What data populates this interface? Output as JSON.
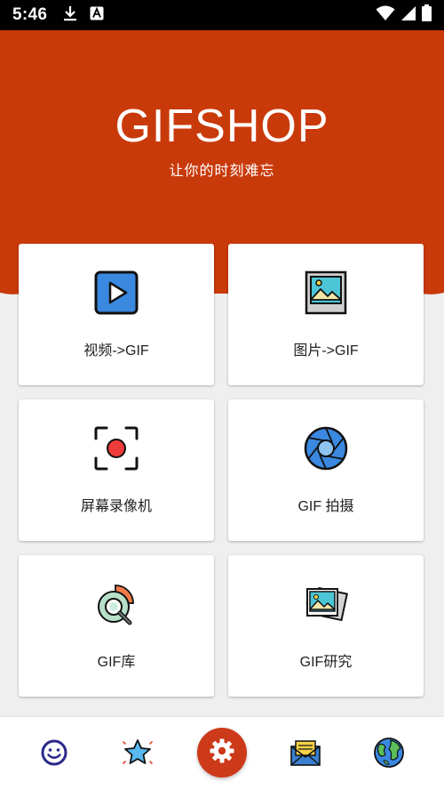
{
  "status_bar": {
    "time": "5:46",
    "notification_icons": [
      "download-icon",
      "font-a-icon"
    ],
    "system_icons": [
      "wifi-icon",
      "signal-icon",
      "battery-icon"
    ]
  },
  "header": {
    "title": "GIFSHOP",
    "slogan": "让你的时刻难忘",
    "background_color": "#c93a0b"
  },
  "tiles": [
    {
      "label": "视频->GIF",
      "icon": "video-play-icon"
    },
    {
      "label": "图片->GIF",
      "icon": "picture-icon"
    },
    {
      "label": "屏幕录像机",
      "icon": "screen-record-icon"
    },
    {
      "label": "GIF 拍摄",
      "icon": "camera-aperture-icon"
    },
    {
      "label": "GIF库",
      "icon": "gif-library-icon"
    },
    {
      "label": "GIF研究",
      "icon": "photos-icon"
    }
  ],
  "bottom_nav": {
    "items": [
      "smiley-icon",
      "star-icon",
      "settings-gear-icon",
      "mail-icon",
      "globe-icon"
    ],
    "active_color": "#cc3a1a"
  }
}
